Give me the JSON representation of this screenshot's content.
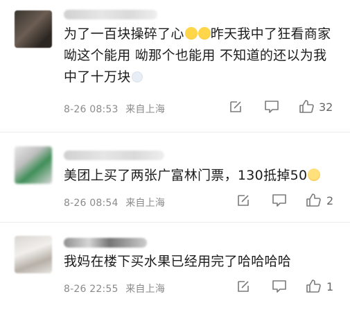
{
  "comments": [
    {
      "text": "为了一百块操碎了心😂😂昨天我中了狂看商家 呦这个也能用 呦那个也能用 不知道的还以为我中了十万块😱",
      "text_parts": [
        "为了一百块操碎了心",
        "昨天我中了狂看商家 呦这个能用 呦那个也能用 不知道的还以为我中了十万块"
      ],
      "date": "8-26 08:53",
      "location": "来自上海",
      "likes": "32"
    },
    {
      "text_parts": [
        "美团上买了两张广富林门票，130抵掉50"
      ],
      "date": "8-26 08:54",
      "location": "来自上海",
      "likes": "2"
    },
    {
      "text_parts": [
        "我妈在楼下买水果已经用完了哈哈哈哈"
      ],
      "date": "8-26 22:55",
      "location": "来自上海",
      "likes": "1"
    }
  ],
  "icons": {
    "share": "share-edit-icon",
    "reply": "comment-bubble-icon",
    "like": "thumbs-up-icon"
  },
  "colors": {
    "text": "#1c1c1c",
    "meta": "#8a8a8a",
    "divider": "#ececec"
  }
}
